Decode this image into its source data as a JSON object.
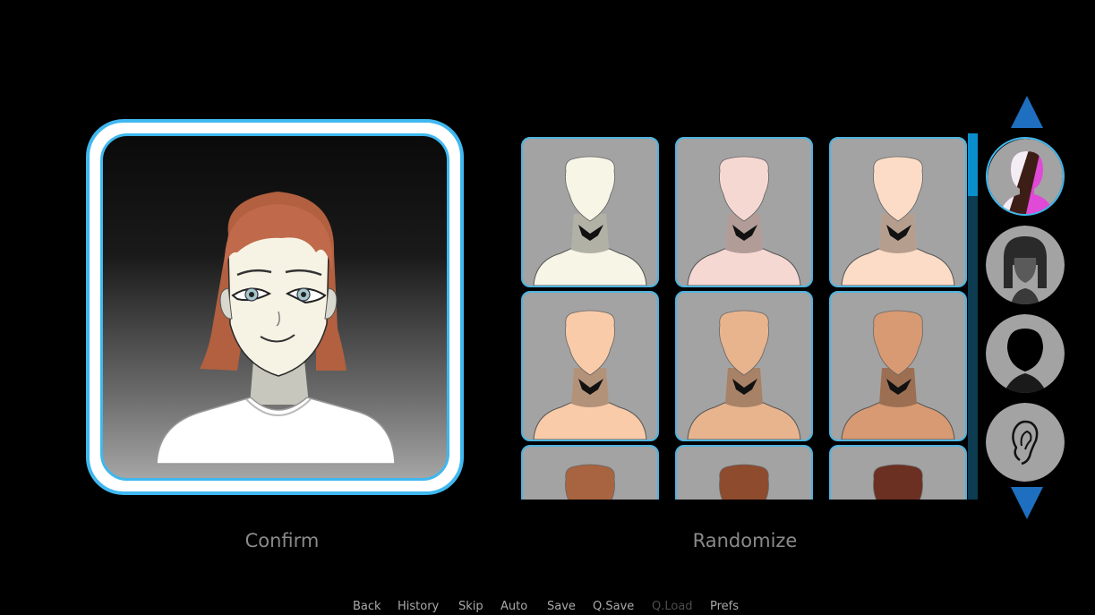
{
  "preview": {
    "hair_color": "#c0694b",
    "skin_color": "#f7f3e4",
    "shirt_color": "#ffffff"
  },
  "skin_tones": [
    {
      "name": "skin-tone-1",
      "color": "#f7f5e6"
    },
    {
      "name": "skin-tone-2",
      "color": "#f6d8d3"
    },
    {
      "name": "skin-tone-3",
      "color": "#fcdcc6"
    },
    {
      "name": "skin-tone-4",
      "color": "#f9cba9"
    },
    {
      "name": "skin-tone-5",
      "color": "#e8b48e"
    },
    {
      "name": "skin-tone-6",
      "color": "#d89a73"
    },
    {
      "name": "skin-tone-7",
      "color": "#a86440"
    },
    {
      "name": "skin-tone-8",
      "color": "#8e4b2e"
    },
    {
      "name": "skin-tone-9",
      "color": "#6b3022"
    }
  ],
  "categories": [
    {
      "icon": "skin-color-icon",
      "selected": true
    },
    {
      "icon": "hair-icon",
      "selected": false
    },
    {
      "icon": "head-shape-icon",
      "selected": false
    },
    {
      "icon": "ear-icon",
      "selected": false
    }
  ],
  "colors": {
    "accent": "#3fb8ef",
    "arrow": "#1e6fbf",
    "scroll_thumb": "#0a8fce",
    "scroll_track": "#0c3b52"
  },
  "actions": {
    "confirm_label": "Confirm",
    "randomize_label": "Randomize"
  },
  "quick_menu": [
    {
      "label": "Back",
      "enabled": true
    },
    {
      "label": "History",
      "enabled": true
    },
    {
      "label": "Skip",
      "enabled": true
    },
    {
      "label": "Auto",
      "enabled": true
    },
    {
      "label": "Save",
      "enabled": true
    },
    {
      "label": "Q.Save",
      "enabled": true
    },
    {
      "label": "Q.Load",
      "enabled": false
    },
    {
      "label": "Prefs",
      "enabled": true
    }
  ]
}
